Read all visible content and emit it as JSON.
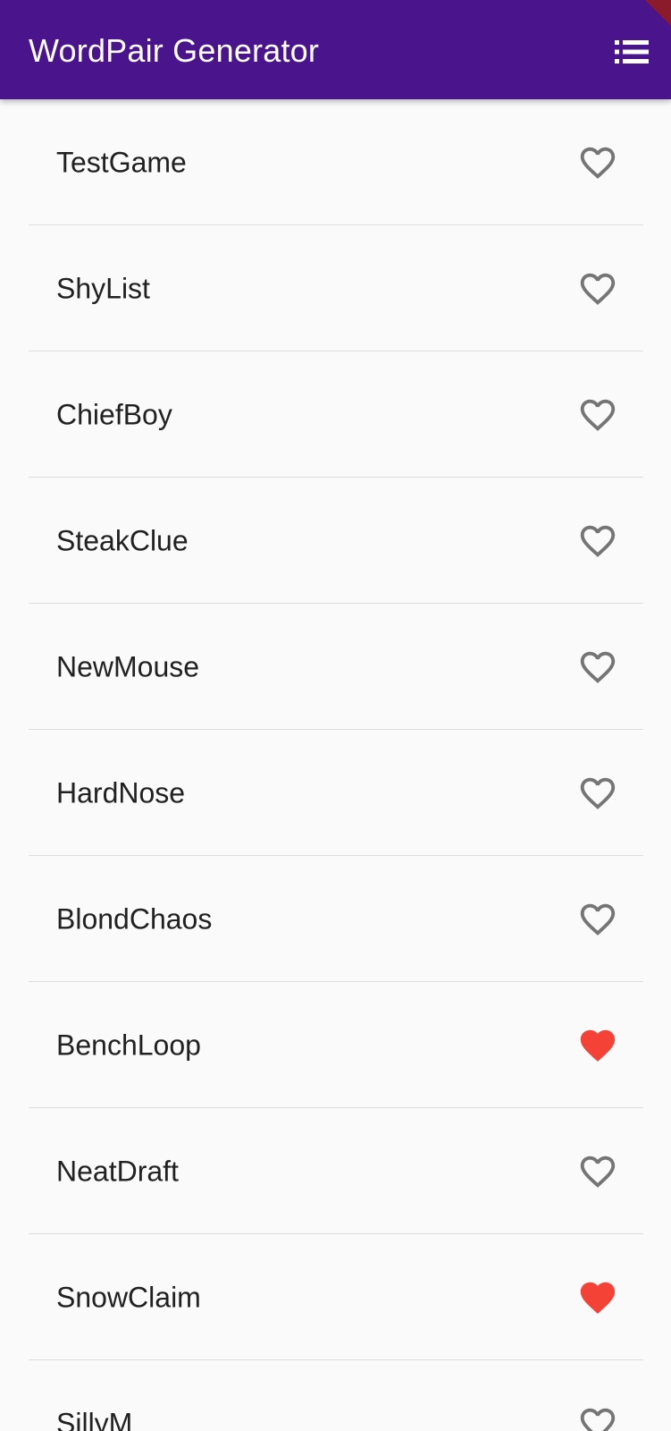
{
  "app": {
    "title": "WordPair Generator",
    "accent_color": "#4a148c",
    "action_icon": "list-icon"
  },
  "colors": {
    "heart_saved": "#f44336",
    "heart_unsaved": "#757575"
  },
  "word_pairs": [
    {
      "label": "TestGame",
      "saved": false
    },
    {
      "label": "ShyList",
      "saved": false
    },
    {
      "label": "ChiefBoy",
      "saved": false
    },
    {
      "label": "SteakClue",
      "saved": false
    },
    {
      "label": "NewMouse",
      "saved": false
    },
    {
      "label": "HardNose",
      "saved": false
    },
    {
      "label": "BlondChaos",
      "saved": false
    },
    {
      "label": "BenchLoop",
      "saved": true
    },
    {
      "label": "NeatDraft",
      "saved": false
    },
    {
      "label": "SnowClaim",
      "saved": true
    },
    {
      "label": "SillyM",
      "saved": false
    }
  ]
}
